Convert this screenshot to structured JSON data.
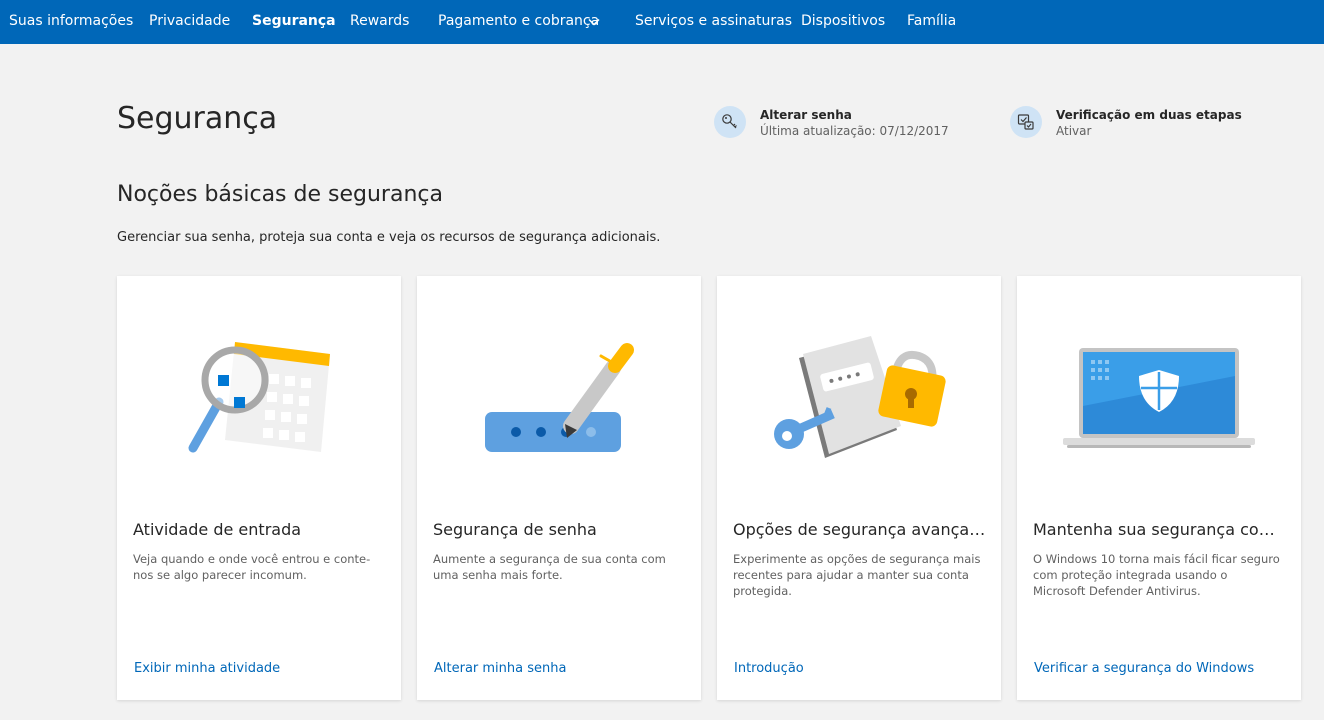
{
  "nav": {
    "items": [
      {
        "label": "Suas informações"
      },
      {
        "label": "Privacidade"
      },
      {
        "label": "Segurança"
      },
      {
        "label": "Rewards"
      },
      {
        "label": "Pagamento e cobrança"
      },
      {
        "label": "Serviços e assinaturas"
      },
      {
        "label": "Dispositivos"
      },
      {
        "label": "Família"
      }
    ],
    "active_label": "Segurança"
  },
  "header": {
    "title": "Segurança",
    "change_password": {
      "title": "Alterar senha",
      "subtitle": "Última atualização: 07/12/2017",
      "icon": "key-icon"
    },
    "two_step": {
      "title": "Verificação em duas etapas",
      "subtitle": "Ativar",
      "icon": "two-step-verification-icon"
    }
  },
  "section": {
    "title": "Noções básicas de segurança",
    "description": "Gerenciar sua senha, proteja sua conta e veja os recursos de segurança adicionais."
  },
  "cards": [
    {
      "title": "Atividade de entrada",
      "description": "Veja quando e onde você entrou e conte-nos se algo parecer incomum.",
      "link": "Exibir minha atividade",
      "icon": "calendar-magnifier-illustration"
    },
    {
      "title": "Segurança de senha",
      "description": "Aumente a segurança de sua conta com uma senha mais forte.",
      "link": "Alterar minha senha",
      "icon": "password-pen-illustration"
    },
    {
      "title": "Opções de segurança avançadas",
      "description": "Experimente as opções de segurança mais recentes para ajudar a manter sua conta protegida.",
      "link": "Introdução",
      "icon": "lock-key-illustration"
    },
    {
      "title": "Mantenha sua segurança com o...",
      "description": "O Windows 10 torna mais fácil ficar seguro com proteção integrada usando o Microsoft Defender Antivirus.",
      "link": "Verificar a segurança do Windows",
      "icon": "laptop-shield-illustration"
    }
  ],
  "colors": {
    "nav_bg": "#0067b8",
    "page_bg": "#f2f2f2",
    "link": "#0067b8",
    "accent_yellow": "#ffb900",
    "illustration_blue": "#0078d4"
  }
}
